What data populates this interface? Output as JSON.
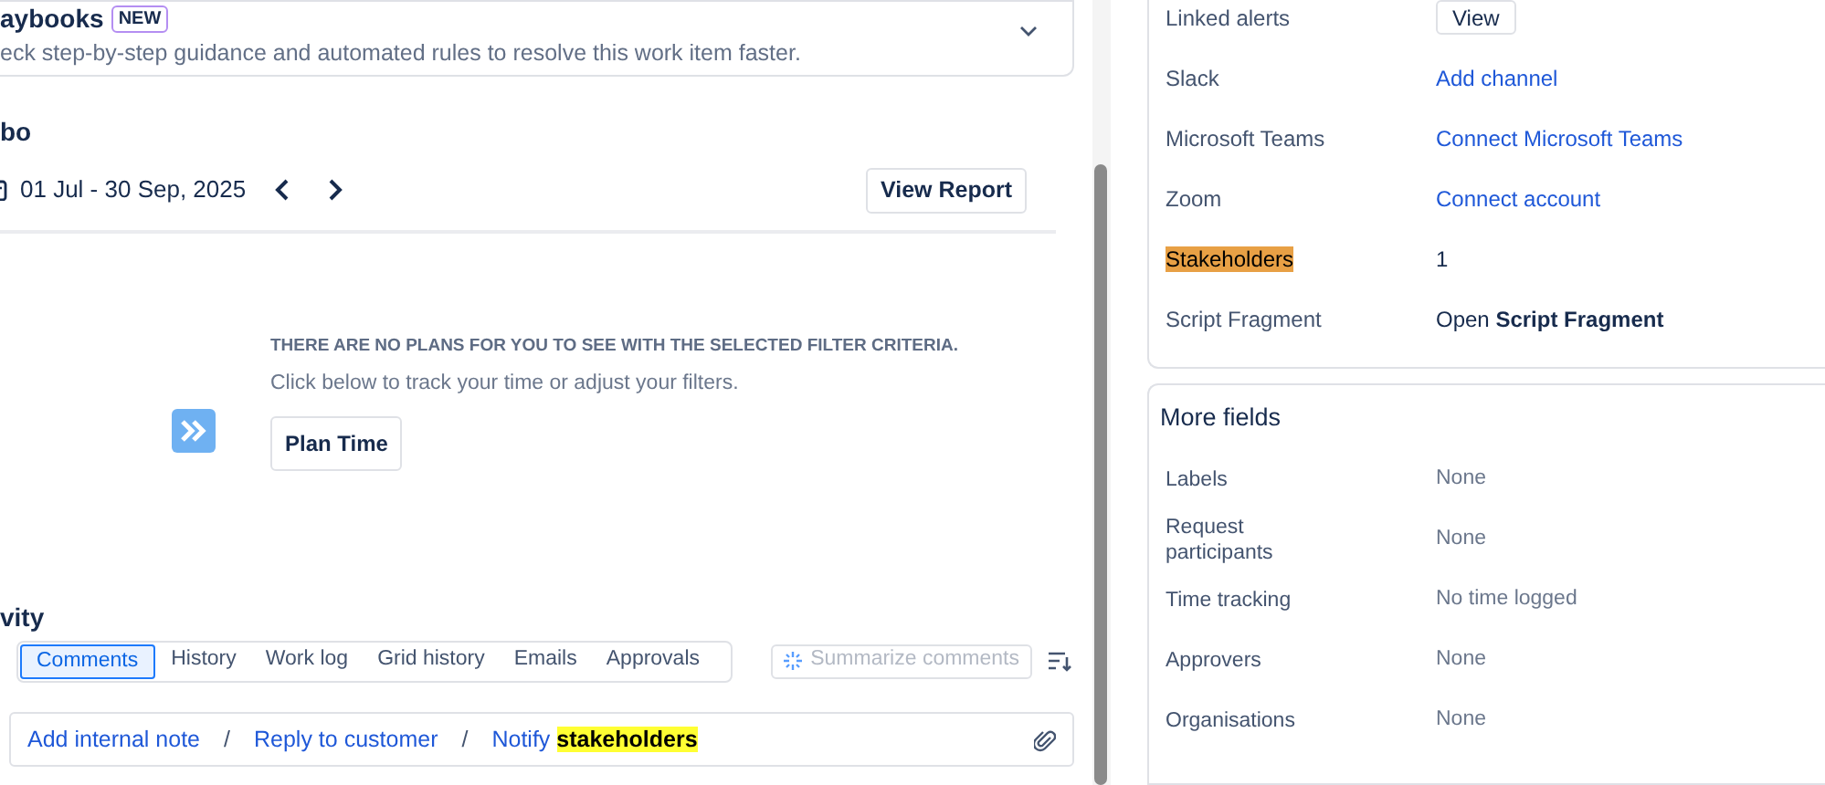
{
  "playbooks": {
    "title": "aybooks",
    "badge": "NEW",
    "description": "eck step-by-step guidance and automated rules to resolve this work item faster.",
    "expanded": false
  },
  "plans": {
    "title": "bo",
    "date_range": "01 Jul - 30 Sep, 2025",
    "view_report": "View Report",
    "empty_title": "THERE ARE NO PLANS FOR YOU TO SEE WITH THE SELECTED FILTER CRITERIA.",
    "empty_text": "Click below to track your time or adjust your filters.",
    "plan_button": "Plan Time"
  },
  "activity": {
    "title": "vity",
    "tabs": [
      {
        "label": "Comments",
        "selected": true
      },
      {
        "label": "History",
        "selected": false
      },
      {
        "label": "Work log",
        "selected": false
      },
      {
        "label": "Grid history",
        "selected": false
      },
      {
        "label": "Emails",
        "selected": false
      },
      {
        "label": "Approvals",
        "selected": false
      }
    ],
    "summarize": {
      "label": "Summarize comments",
      "disabled": true
    },
    "comment_actions": [
      {
        "label": "Add internal note"
      },
      {
        "separator": "/",
        "label": "Reply to customer"
      },
      {
        "separator": "/",
        "label": "Notify",
        "highlight": "stakeholders"
      }
    ]
  },
  "details": [
    {
      "label": "Linked alerts",
      "kind": "button",
      "value": "View"
    },
    {
      "label": "Slack",
      "kind": "link",
      "value": "Add channel"
    },
    {
      "label": "Microsoft Teams",
      "kind": "link",
      "value": "Connect Microsoft Teams"
    },
    {
      "label": "Zoom",
      "kind": "link",
      "value": "Connect account"
    },
    {
      "label": "Stakeholders",
      "kind": "text",
      "value": "1",
      "highlighted": true
    },
    {
      "label": "Script Fragment",
      "kind": "text",
      "value": "Open **Script Fragment**"
    }
  ],
  "more_fields": {
    "title": "More fields",
    "fields": [
      {
        "label": "Labels",
        "value": "None"
      },
      {
        "label": "Request participants",
        "value": "None"
      },
      {
        "label": "Time tracking",
        "value": "No time logged"
      },
      {
        "label": "Approvers",
        "value": "None"
      },
      {
        "label": "Organisations",
        "value": "None"
      }
    ]
  }
}
